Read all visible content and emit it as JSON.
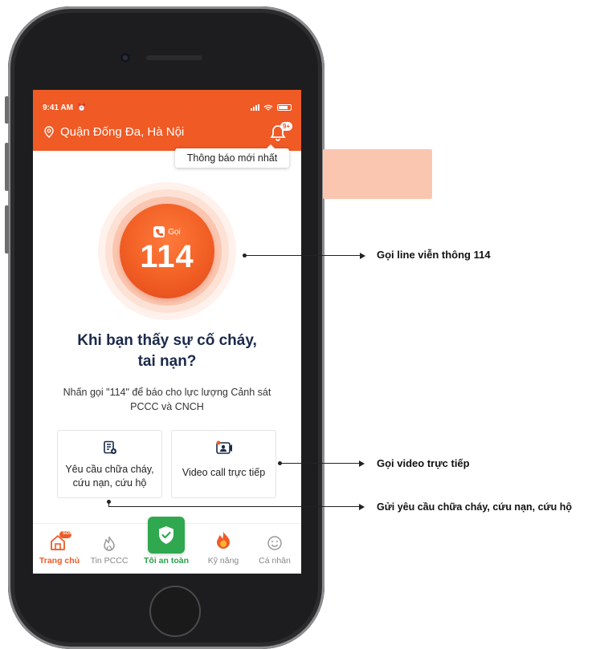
{
  "status_bar": {
    "time": "9:41 AM"
  },
  "header": {
    "location": "Quận Đống Đa, Hà Nội",
    "notification_badge": "9+",
    "tooltip": "Thông báo mới nhất"
  },
  "call": {
    "label": "Gọi",
    "number": "114"
  },
  "main": {
    "heading_line1": "Khi bạn thấy sự cố cháy,",
    "heading_line2": "tai nạn?",
    "description": "Nhấn gọi \"114\" để báo cho lực lượng Cảnh sát PCCC và CNCH"
  },
  "actions": [
    {
      "label": "Yêu cầu chữa cháy, cứu nạn, cứu hộ",
      "icon": "request-form-icon"
    },
    {
      "label": "Video call trực tiếp",
      "icon": "video-call-icon"
    }
  ],
  "nav": [
    {
      "label": "Trang chủ",
      "icon": "home-sos-icon",
      "badge": "SOS"
    },
    {
      "label": "Tin PCCC",
      "icon": "fire-news-icon"
    },
    {
      "label": "Tôi an toàn",
      "icon": "shield-check-icon"
    },
    {
      "label": "Kỹ năng",
      "icon": "skills-fire-icon"
    },
    {
      "label": "Cá nhân",
      "icon": "smile-icon"
    }
  ],
  "annotations": {
    "call_114": "Gọi line viễn thông 114",
    "video": "Gọi video trực tiếp",
    "request": "Gửi yêu cầu chữa cháy, cứu nạn, cứu hộ"
  },
  "colors": {
    "brand": "#ef5a25",
    "safe": "#2fa84f",
    "heading": "#1b2a4b"
  }
}
